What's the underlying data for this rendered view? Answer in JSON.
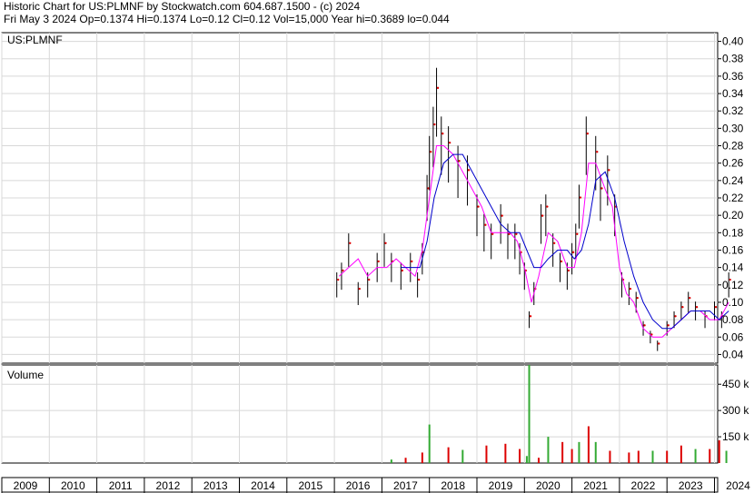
{
  "header": {
    "line1": "Historic Chart for US:PLMNF by Stockwatch.com 604.687.1500 - (c) 2024",
    "line2": "Fri May  3 2024   Op=0.1374  Hi=0.1374  Lo=0.12  Cl=0.12  Vol=15,000  Year hi=0.3689  lo=0.044"
  },
  "colors": {
    "grid": "#d8d8d8",
    "frame": "#000000",
    "price": "#000000",
    "close_dot": "#dd0000",
    "ma_short": "#ff00ff",
    "ma_long": "#0000cc",
    "vol_up": "#33aa33",
    "vol_down": "#dd0000"
  },
  "chart_data": [
    {
      "type": "line",
      "title": "US:PLMNF",
      "ylim": [
        0.03,
        0.41
      ],
      "y_ticks": [
        "0.04",
        "0.06",
        "0.08",
        "0.10",
        "0.12",
        "0.14",
        "0.16",
        "0.18",
        "0.20",
        "0.22",
        "0.24",
        "0.26",
        "0.28",
        "0.30",
        "0.32",
        "0.34",
        "0.36",
        "0.38",
        "0.40"
      ],
      "xlim": [
        2009,
        2024.45
      ],
      "grid": true,
      "series": [
        {
          "kind": "price",
          "x": [
            2016.05,
            2016.15,
            2016.3,
            2016.5,
            2016.7,
            2016.9,
            2017.05,
            2017.2,
            2017.4,
            2017.6,
            2017.75,
            2017.85,
            2017.95,
            2018.0,
            2018.08,
            2018.15,
            2018.25,
            2018.4,
            2018.6,
            2018.8,
            2019.0,
            2019.15,
            2019.3,
            2019.5,
            2019.65,
            2019.8,
            2019.9,
            2020.0,
            2020.1,
            2020.2,
            2020.35,
            2020.45,
            2020.6,
            2020.75,
            2020.9,
            2021.0,
            2021.08,
            2021.15,
            2021.3,
            2021.5,
            2021.6,
            2021.75,
            2021.9,
            2022.05,
            2022.2,
            2022.35,
            2022.5,
            2022.65,
            2022.8,
            2023.0,
            2023.15,
            2023.3,
            2023.45,
            2023.6,
            2023.8,
            2024.0,
            2024.15,
            2024.3
          ],
          "y": [
            0.12,
            0.13,
            0.16,
            0.11,
            0.12,
            0.14,
            0.16,
            0.14,
            0.13,
            0.14,
            0.12,
            0.15,
            0.22,
            0.26,
            0.29,
            0.33,
            0.28,
            0.27,
            0.25,
            0.24,
            0.2,
            0.18,
            0.17,
            0.19,
            0.17,
            0.17,
            0.15,
            0.13,
            0.08,
            0.11,
            0.19,
            0.2,
            0.16,
            0.14,
            0.13,
            0.15,
            0.17,
            0.21,
            0.28,
            0.26,
            0.22,
            0.24,
            0.2,
            0.12,
            0.11,
            0.1,
            0.07,
            0.06,
            0.05,
            0.07,
            0.08,
            0.09,
            0.1,
            0.09,
            0.08,
            0.09,
            0.08,
            0.12
          ]
        },
        {
          "kind": "ma_short",
          "x": [
            2016.1,
            2016.3,
            2016.5,
            2016.7,
            2016.9,
            2017.1,
            2017.3,
            2017.5,
            2017.7,
            2017.85,
            2018.0,
            2018.15,
            2018.3,
            2018.5,
            2018.7,
            2018.9,
            2019.1,
            2019.3,
            2019.5,
            2019.7,
            2019.85,
            2020.0,
            2020.15,
            2020.3,
            2020.5,
            2020.7,
            2020.9,
            2021.05,
            2021.2,
            2021.35,
            2021.5,
            2021.7,
            2021.85,
            2022.0,
            2022.15,
            2022.3,
            2022.5,
            2022.7,
            2022.9,
            2023.1,
            2023.3,
            2023.5,
            2023.7,
            2023.9,
            2024.1,
            2024.3
          ],
          "y": [
            0.13,
            0.14,
            0.15,
            0.13,
            0.14,
            0.14,
            0.15,
            0.14,
            0.13,
            0.16,
            0.22,
            0.28,
            0.28,
            0.27,
            0.25,
            0.23,
            0.21,
            0.18,
            0.18,
            0.18,
            0.17,
            0.14,
            0.1,
            0.13,
            0.18,
            0.17,
            0.14,
            0.14,
            0.18,
            0.26,
            0.26,
            0.23,
            0.21,
            0.14,
            0.11,
            0.1,
            0.07,
            0.06,
            0.06,
            0.07,
            0.08,
            0.09,
            0.09,
            0.08,
            0.08,
            0.1
          ]
        },
        {
          "kind": "ma_long",
          "x": [
            2017.4,
            2017.6,
            2017.8,
            2017.95,
            2018.1,
            2018.3,
            2018.5,
            2018.7,
            2018.9,
            2019.1,
            2019.3,
            2019.5,
            2019.7,
            2019.9,
            2020.05,
            2020.2,
            2020.35,
            2020.5,
            2020.7,
            2020.9,
            2021.05,
            2021.2,
            2021.35,
            2021.5,
            2021.7,
            2021.9,
            2022.1,
            2022.3,
            2022.5,
            2022.7,
            2022.9,
            2023.1,
            2023.3,
            2023.5,
            2023.7,
            2023.9,
            2024.1,
            2024.3
          ],
          "y": [
            0.14,
            0.14,
            0.14,
            0.17,
            0.22,
            0.26,
            0.27,
            0.27,
            0.25,
            0.23,
            0.21,
            0.19,
            0.18,
            0.18,
            0.16,
            0.14,
            0.14,
            0.15,
            0.16,
            0.16,
            0.15,
            0.16,
            0.19,
            0.24,
            0.25,
            0.22,
            0.17,
            0.13,
            0.1,
            0.08,
            0.07,
            0.07,
            0.08,
            0.09,
            0.09,
            0.09,
            0.08,
            0.09
          ]
        }
      ]
    },
    {
      "type": "bar",
      "title": "Volume",
      "ylim": [
        0,
        560
      ],
      "y_ticks": [
        "150 k",
        "300 k",
        "450 k"
      ],
      "y_tick_values": [
        150,
        300,
        450
      ],
      "x": [
        2017.2,
        2017.5,
        2017.85,
        2018.0,
        2018.4,
        2018.7,
        2019.2,
        2019.6,
        2019.9,
        2020.05,
        2020.1,
        2020.3,
        2020.5,
        2020.8,
        2021.0,
        2021.15,
        2021.35,
        2021.5,
        2021.8,
        2022.2,
        2022.4,
        2022.7,
        2023.0,
        2023.3,
        2023.6,
        2023.9,
        2024.1,
        2024.25
      ],
      "values": [
        20,
        30,
        60,
        220,
        90,
        75,
        100,
        110,
        80,
        40,
        560,
        30,
        150,
        120,
        80,
        120,
        210,
        120,
        70,
        60,
        70,
        70,
        70,
        100,
        80,
        80,
        130,
        70
      ],
      "up": [
        true,
        false,
        false,
        true,
        false,
        true,
        false,
        false,
        false,
        true,
        true,
        false,
        true,
        false,
        false,
        true,
        false,
        true,
        false,
        false,
        false,
        true,
        false,
        false,
        true,
        false,
        false,
        true
      ]
    }
  ],
  "x_axis": {
    "years": [
      "2009",
      "2010",
      "2011",
      "2012",
      "2013",
      "2014",
      "2015",
      "2016",
      "2017",
      "2018",
      "2019",
      "2020",
      "2021",
      "2022",
      "2023",
      "2024"
    ]
  }
}
